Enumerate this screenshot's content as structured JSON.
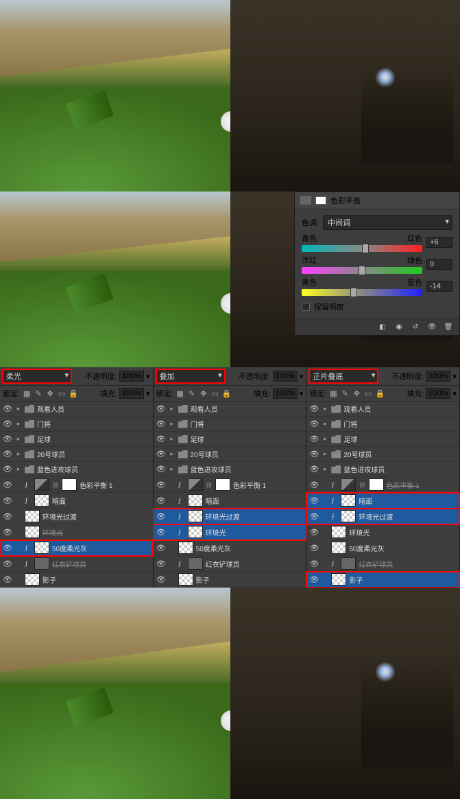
{
  "colorBalance": {
    "title": "色彩平衡",
    "toneLabel": "色调:",
    "toneValue": "中间调",
    "sliders": [
      {
        "left": "青色",
        "right": "红色",
        "value": "+6",
        "pos": 53
      },
      {
        "left": "洋红",
        "right": "绿色",
        "value": "0",
        "pos": 50
      },
      {
        "left": "黄色",
        "right": "蓝色",
        "value": "-14",
        "pos": 43
      }
    ],
    "preserveLuminosity": "保留明度"
  },
  "panels": [
    {
      "blend": "柔光",
      "opacity": "不透明度:",
      "opacityVal": "100%",
      "lock": "锁定:",
      "fill": "填充:",
      "fillVal": "100%",
      "highlightBlend": true,
      "layers": [
        {
          "type": "group",
          "name": "观看人员",
          "vis": true
        },
        {
          "type": "group",
          "name": "门将",
          "vis": true
        },
        {
          "type": "group",
          "name": "足球",
          "vis": true
        },
        {
          "type": "group",
          "name": "20号球员",
          "vis": true
        },
        {
          "type": "group",
          "name": "蓝色进攻球员",
          "vis": true
        },
        {
          "type": "adj",
          "name": "色彩平衡 1",
          "vis": true,
          "fx": true,
          "mask": true
        },
        {
          "type": "layer",
          "name": "暗面",
          "vis": true,
          "fx": true,
          "checker": true
        },
        {
          "type": "layer",
          "name": "环境光过渡",
          "vis": true,
          "checker": true
        },
        {
          "type": "layer",
          "name": "环境光",
          "vis": true,
          "checker": true,
          "strike": true,
          "redbox": false
        },
        {
          "type": "layer",
          "name": "50度柔光灰",
          "vis": true,
          "fx": true,
          "checker": true,
          "selected": true,
          "redbox": true
        },
        {
          "type": "layer",
          "name": "红衣铲球员",
          "vis": true,
          "fx": true,
          "strike": true
        },
        {
          "type": "layer",
          "name": "影子",
          "vis": true,
          "checker": true
        }
      ]
    },
    {
      "blend": "叠加",
      "opacity": "不透明度:",
      "opacityVal": "100%",
      "lock": "锁定:",
      "fill": "填充:",
      "fillVal": "100%",
      "highlightBlend": true,
      "layers": [
        {
          "type": "group",
          "name": "观看人员",
          "vis": true
        },
        {
          "type": "group",
          "name": "门将",
          "vis": true
        },
        {
          "type": "group",
          "name": "足球",
          "vis": true
        },
        {
          "type": "group",
          "name": "20号球员",
          "vis": true
        },
        {
          "type": "group",
          "name": "蓝色进攻球员",
          "vis": true
        },
        {
          "type": "adj",
          "name": "色彩平衡 1",
          "vis": true,
          "fx": true,
          "mask": true
        },
        {
          "type": "layer",
          "name": "暗面",
          "vis": true,
          "fx": true,
          "checker": true
        },
        {
          "type": "layer",
          "name": "环境光过渡",
          "vis": true,
          "fx": true,
          "checker": true,
          "selected": true,
          "redbox": true
        },
        {
          "type": "layer",
          "name": "环境光",
          "vis": true,
          "fx": true,
          "checker": true,
          "selected": true,
          "redbox": true
        },
        {
          "type": "layer",
          "name": "50度柔光灰",
          "vis": true,
          "checker": true
        },
        {
          "type": "layer",
          "name": "红衣铲球员",
          "vis": true,
          "fx": true
        },
        {
          "type": "layer",
          "name": "影子",
          "vis": true,
          "checker": true
        }
      ]
    },
    {
      "blend": "正片叠底",
      "opacity": "不透明度:",
      "opacityVal": "100%",
      "lock": "锁定:",
      "fill": "填充:",
      "fillVal": "100%",
      "highlightBlend": true,
      "layers": [
        {
          "type": "group",
          "name": "观看人员",
          "vis": true
        },
        {
          "type": "group",
          "name": "门将",
          "vis": true
        },
        {
          "type": "group",
          "name": "足球",
          "vis": true
        },
        {
          "type": "group",
          "name": "20号球员",
          "vis": true
        },
        {
          "type": "group",
          "name": "蓝色进攻球员",
          "vis": true
        },
        {
          "type": "adj",
          "name": "色彩平衡 1",
          "vis": true,
          "fx": true,
          "mask": true,
          "strike": true
        },
        {
          "type": "layer",
          "name": "暗面",
          "vis": true,
          "fx": true,
          "checker": true,
          "selected": true,
          "redbox": true
        },
        {
          "type": "layer",
          "name": "环境光过渡",
          "vis": true,
          "fx": true,
          "checker": true,
          "selected": true,
          "redbox": true
        },
        {
          "type": "layer",
          "name": "环境光",
          "vis": true,
          "checker": true
        },
        {
          "type": "layer",
          "name": "50度柔光灰",
          "vis": true,
          "checker": true
        },
        {
          "type": "layer",
          "name": "红衣铲球员",
          "vis": true,
          "fx": true,
          "strike": true
        },
        {
          "type": "layer",
          "name": "影子",
          "vis": true,
          "checker": true,
          "selected": true,
          "redbox": true
        }
      ]
    }
  ]
}
